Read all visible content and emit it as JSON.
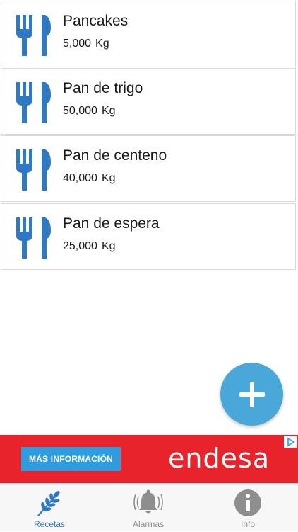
{
  "recipes": [
    {
      "name": "Pancakes",
      "amount": "5,000",
      "unit": "Kg"
    },
    {
      "name": "Pan de trigo",
      "amount": "50,000",
      "unit": "Kg"
    },
    {
      "name": "Pan de centeno",
      "amount": "40,000",
      "unit": "Kg"
    },
    {
      "name": "Pan de espera",
      "amount": "25,000",
      "unit": "Kg"
    }
  ],
  "recipe_icon": "fork-knife-icon",
  "fab": {
    "icon": "plus-icon"
  },
  "ad": {
    "button_label": "MÁS INFORMACIÓN",
    "brand": "endesa",
    "background_color": "#e9232b",
    "button_color": "#2d9de0"
  },
  "tabs": [
    {
      "label": "Recetas",
      "icon": "wheat-icon",
      "active": true
    },
    {
      "label": "Alarmas",
      "icon": "bell-icon",
      "active": false
    },
    {
      "label": "Info",
      "icon": "info-icon",
      "active": false
    }
  ],
  "colors": {
    "accent": "#2f78c4",
    "fab": "#4aa8d8",
    "inactive": "#8e8e8e"
  }
}
